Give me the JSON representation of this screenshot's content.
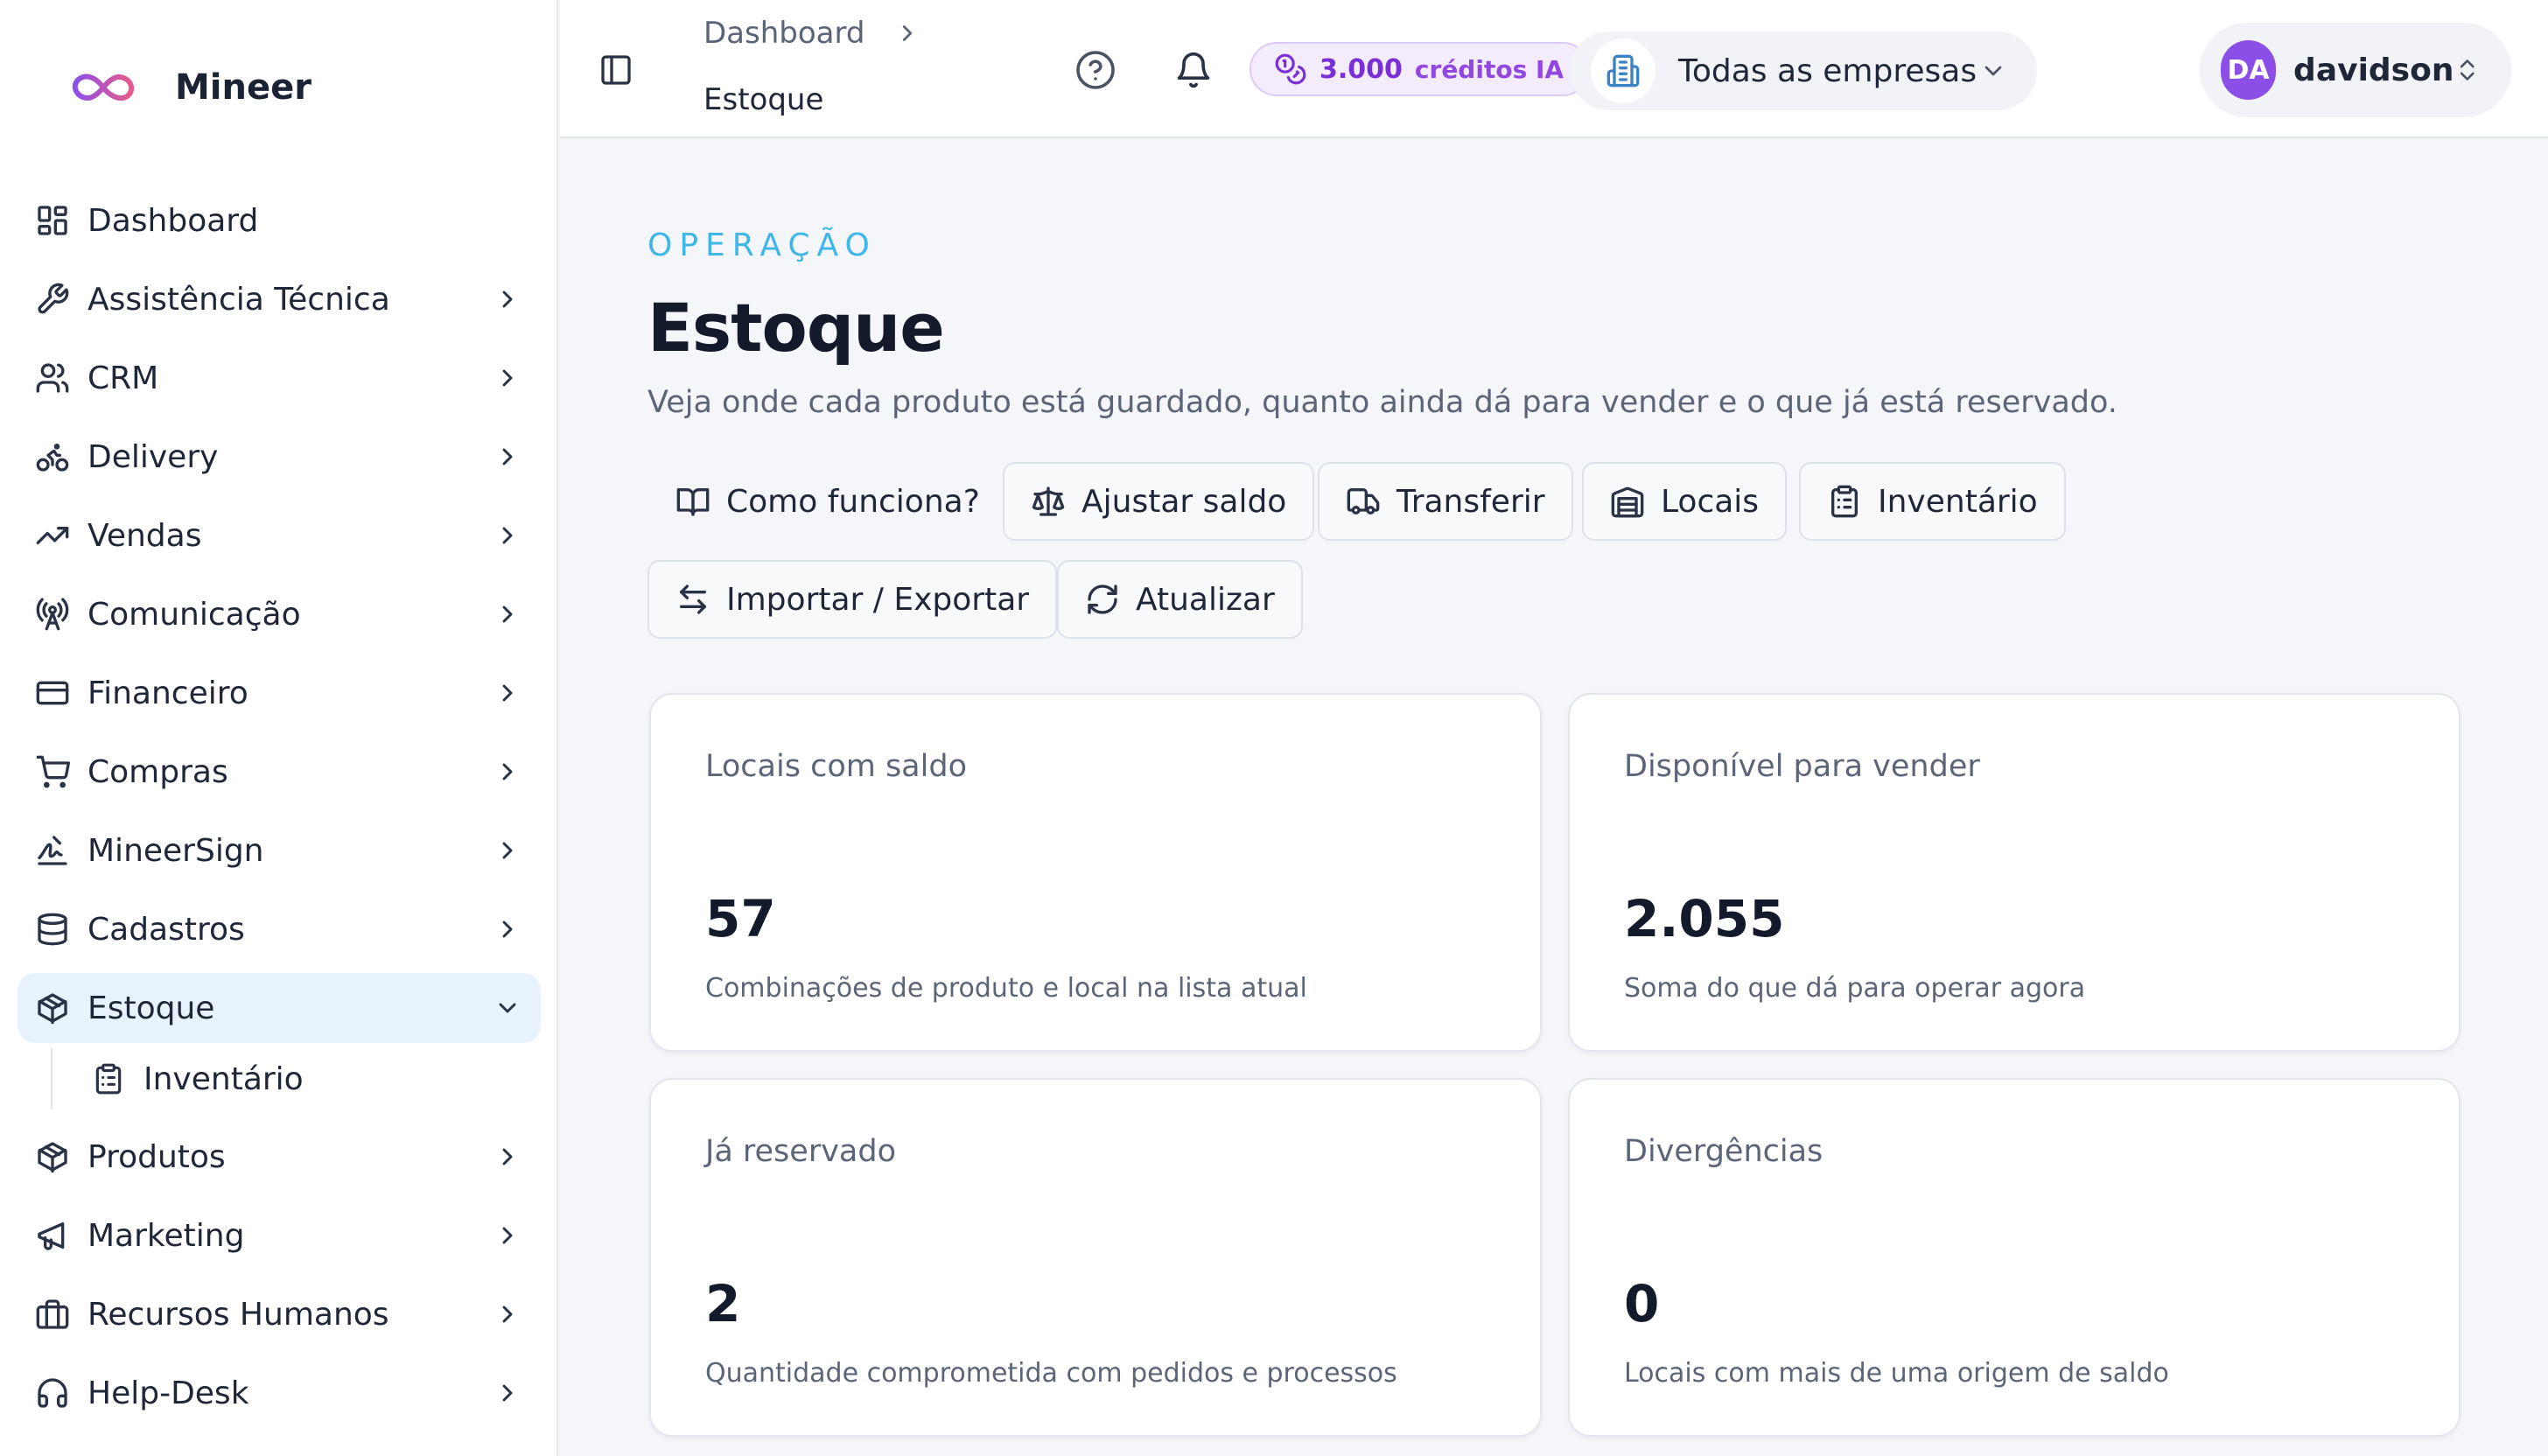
{
  "app": {
    "name": "Mineer"
  },
  "sidebar": {
    "items": [
      {
        "label": "Dashboard",
        "icon": "dashboard-grid-icon",
        "expandable": false
      },
      {
        "label": "Assistência Técnica",
        "icon": "wrench-icon",
        "expandable": true
      },
      {
        "label": "CRM",
        "icon": "users-icon",
        "expandable": true
      },
      {
        "label": "Delivery",
        "icon": "bike-icon",
        "expandable": true
      },
      {
        "label": "Vendas",
        "icon": "trending-up-icon",
        "expandable": true
      },
      {
        "label": "Comunicação",
        "icon": "radio-tower-icon",
        "expandable": true
      },
      {
        "label": "Financeiro",
        "icon": "credit-card-icon",
        "expandable": true
      },
      {
        "label": "Compras",
        "icon": "shopping-cart-icon",
        "expandable": true
      },
      {
        "label": "MineerSign",
        "icon": "signature-icon",
        "expandable": true
      },
      {
        "label": "Cadastros",
        "icon": "database-icon",
        "expandable": true
      },
      {
        "label": "Estoque",
        "icon": "package-icon",
        "expandable": true,
        "active": true,
        "expanded": true
      },
      {
        "label": "Produtos",
        "icon": "package-icon",
        "expandable": true
      },
      {
        "label": "Marketing",
        "icon": "megaphone-icon",
        "expandable": true
      },
      {
        "label": "Recursos Humanos",
        "icon": "briefcase-icon",
        "expandable": true
      },
      {
        "label": "Help-Desk",
        "icon": "headphones-icon",
        "expandable": true
      }
    ],
    "subitems": [
      {
        "label": "Inventário",
        "icon": "clipboard-list-icon"
      }
    ]
  },
  "topbar": {
    "breadcrumb": [
      "Dashboard",
      "Estoque"
    ],
    "credits": {
      "amount": "3.000",
      "label": "créditos IA"
    },
    "company_selector": "Todas as empresas",
    "user": {
      "initials": "DA",
      "name": "davidson"
    }
  },
  "page": {
    "eyebrow": "OPERAÇÃO",
    "title": "Estoque",
    "subtitle": "Veja onde cada produto está guardado, quanto ainda dá para vender e o que já está reservado.",
    "actions": [
      {
        "label": "Como funciona?",
        "icon": "book-open-icon"
      },
      {
        "label": "Ajustar saldo",
        "icon": "scale-icon"
      },
      {
        "label": "Transferir",
        "icon": "truck-icon"
      },
      {
        "label": "Locais",
        "icon": "warehouse-icon"
      },
      {
        "label": "Inventário",
        "icon": "clipboard-list-icon"
      },
      {
        "label": "Importar / Exportar",
        "icon": "arrows-left-right-icon"
      },
      {
        "label": "Atualizar",
        "icon": "refresh-icon"
      }
    ]
  },
  "stats": [
    {
      "title": "Locais com saldo",
      "value": "57",
      "description": "Combinações de produto e local na lista atual"
    },
    {
      "title": "Disponível para vender",
      "value": "2.055",
      "description": "Soma do que dá para operar agora"
    },
    {
      "title": "Já reservado",
      "value": "2",
      "description": "Quantidade comprometida com pedidos e processos"
    },
    {
      "title": "Divergências",
      "value": "0",
      "description": "Locais com mais de uma origem de saldo"
    }
  ],
  "colors": {
    "accent_eyebrow": "#3fb6e8",
    "active_nav_bg": "#e8f2fd",
    "credits_purple": "#7a2fd6",
    "avatar_purple": "#8b4fe8",
    "logo_gradient": [
      "#8b4fe8",
      "#e85a8b"
    ]
  }
}
